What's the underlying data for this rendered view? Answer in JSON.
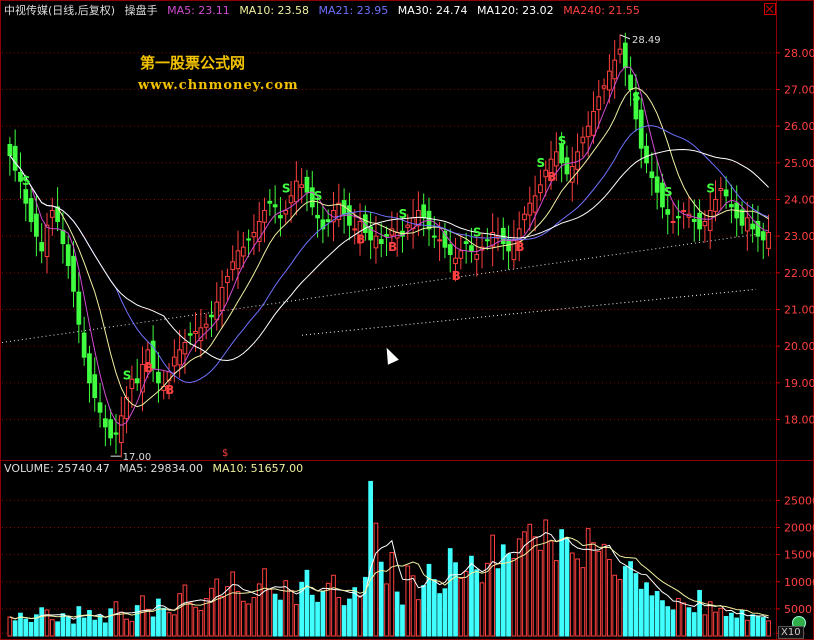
{
  "header": {
    "stock": "中视传媒(日线,后复权)",
    "tool": "操盘手",
    "ma": [
      {
        "label": "MA5: 23.11",
        "color": "#d04cd0"
      },
      {
        "label": "MA10: 23.58",
        "color": "#f0f0a0"
      },
      {
        "label": "MA21: 23.95",
        "color": "#7070ff"
      },
      {
        "label": "MA30: 24.74",
        "color": "#ffffff"
      },
      {
        "label": "MA120: 23.02",
        "color": "#ffffff"
      },
      {
        "label": "MA240: 21.55",
        "color": "#ff4040"
      }
    ]
  },
  "volume_header": {
    "label": "VOLUME: 25740.47",
    "ma5": "MA5: 29834.00",
    "ma10": "MA10: 51657.00"
  },
  "watermark": {
    "title": "第一股票公式网",
    "url": "www.chnmoney.com"
  },
  "button": {
    "x10": "X10"
  },
  "colors": {
    "up": "#ff4040",
    "down": "#40ff40",
    "vol_up": "#ff4040",
    "vol_down": "#40ffff",
    "grid": "#8b0000"
  },
  "chart_data": [
    {
      "type": "candlestick",
      "y_ticks": [
        18.0,
        19.0,
        20.0,
        21.0,
        22.0,
        23.0,
        24.0,
        25.0,
        26.0,
        27.0,
        28.0
      ],
      "ylim": [
        16.95,
        28.95
      ],
      "annotations": [
        {
          "text": "28.49",
          "value": 28.49
        },
        {
          "text": "17.00",
          "value": 17.0
        }
      ],
      "signals": [
        "S",
        "S",
        "S",
        "S",
        "S",
        "S",
        "S",
        "S",
        "S",
        "S",
        "S",
        "B",
        "B",
        "B",
        "B",
        "B",
        "B",
        "B"
      ],
      "extra_mark": "$",
      "closes": [
        25.2,
        24.8,
        24.5,
        23.9,
        23.4,
        23.0,
        22.6,
        23.3,
        23.7,
        23.4,
        22.8,
        22.2,
        21.5,
        20.6,
        19.7,
        19.0,
        18.6,
        18.2,
        17.8,
        17.5,
        17.6,
        18.1,
        18.6,
        19.1,
        19.0,
        19.5,
        19.9,
        19.4,
        19.0,
        18.9,
        19.3,
        19.7,
        19.9,
        20.1,
        20.3,
        20.4,
        20.5,
        20.6,
        20.8,
        21.2,
        21.6,
        21.9,
        22.3,
        22.6,
        22.7,
        22.9,
        23.1,
        23.4,
        23.7,
        23.9,
        23.8,
        23.5,
        23.7,
        24.1,
        24.5,
        24.4,
        24.2,
        23.8,
        23.5,
        23.2,
        23.4,
        23.7,
        23.9,
        23.6,
        23.3,
        23.2,
        23.4,
        23.1,
        22.9,
        23.0,
        22.8,
        23.0,
        23.2,
        23.1,
        23.0,
        23.3,
        23.5,
        23.7,
        23.5,
        23.2,
        23.0,
        22.9,
        22.7,
        22.5,
        22.4,
        22.6,
        22.8,
        22.6,
        22.5,
        22.7,
        22.9,
        23.1,
        23.0,
        22.8,
        22.6,
        22.9,
        23.2,
        23.6,
        23.9,
        24.1,
        24.4,
        24.8,
        25.1,
        25.3,
        25.0,
        24.7,
        24.9,
        25.3,
        25.7,
        26.0,
        26.4,
        26.8,
        27.1,
        27.5,
        27.8,
        28.1,
        27.6,
        27.0,
        26.2,
        25.4,
        25.0,
        24.6,
        24.2,
        23.8,
        23.6,
        23.4,
        23.5,
        23.7,
        23.6,
        23.4,
        23.2,
        23.4,
        23.7,
        24.0,
        24.3,
        24.1,
        23.8,
        23.5,
        23.3,
        23.5,
        23.2,
        23.0,
        22.9,
        23.1
      ]
    },
    {
      "type": "bar",
      "y_ticks": [
        500,
        5000,
        10000,
        15000,
        20000,
        25000
      ],
      "ylim": [
        0,
        29500
      ],
      "values": [
        3500,
        2800,
        4200,
        3100,
        2500,
        3900,
        5200,
        4800,
        3000,
        2600,
        4100,
        3600,
        2200,
        5400,
        3300,
        4700,
        2900,
        3800,
        2400,
        5000,
        6300,
        4400,
        3100,
        2700,
        5600,
        7400,
        4900,
        3500,
        6800,
        5100,
        4300,
        3900,
        7800,
        9400,
        6100,
        5300,
        4700,
        6900,
        8800,
        10500,
        7300,
        9100,
        11800,
        8200,
        6400,
        5900,
        7100,
        9600,
        12400,
        8600,
        7700,
        6600,
        10200,
        8400,
        5800,
        9900,
        12100,
        7500,
        6200,
        8300,
        9700,
        11200,
        7100,
        5600,
        6800,
        8900,
        7400,
        10800,
        28500,
        20800,
        13600,
        9600,
        15400,
        8100,
        5700,
        12900,
        11100,
        6700,
        9300,
        13200,
        10400,
        7800,
        8700,
        16100,
        13500,
        10600,
        11900,
        14700,
        12200,
        9800,
        13400,
        18600,
        12400,
        16800,
        15100,
        14300,
        17900,
        19200,
        20600,
        18300,
        15800,
        21400,
        17500,
        13900,
        19600,
        18100,
        15300,
        14200,
        12600,
        19800,
        17200,
        15600,
        16900,
        14100,
        11200,
        10400,
        12800,
        13700,
        11500,
        8600,
        9800,
        7400,
        8200,
        6500,
        5400,
        4800,
        6900,
        6100,
        5200,
        4300,
        8400,
        3900,
        6300,
        4400,
        5100,
        3600,
        4200,
        3300,
        4700,
        2900,
        3900,
        3600,
        3400,
        2800
      ]
    }
  ]
}
